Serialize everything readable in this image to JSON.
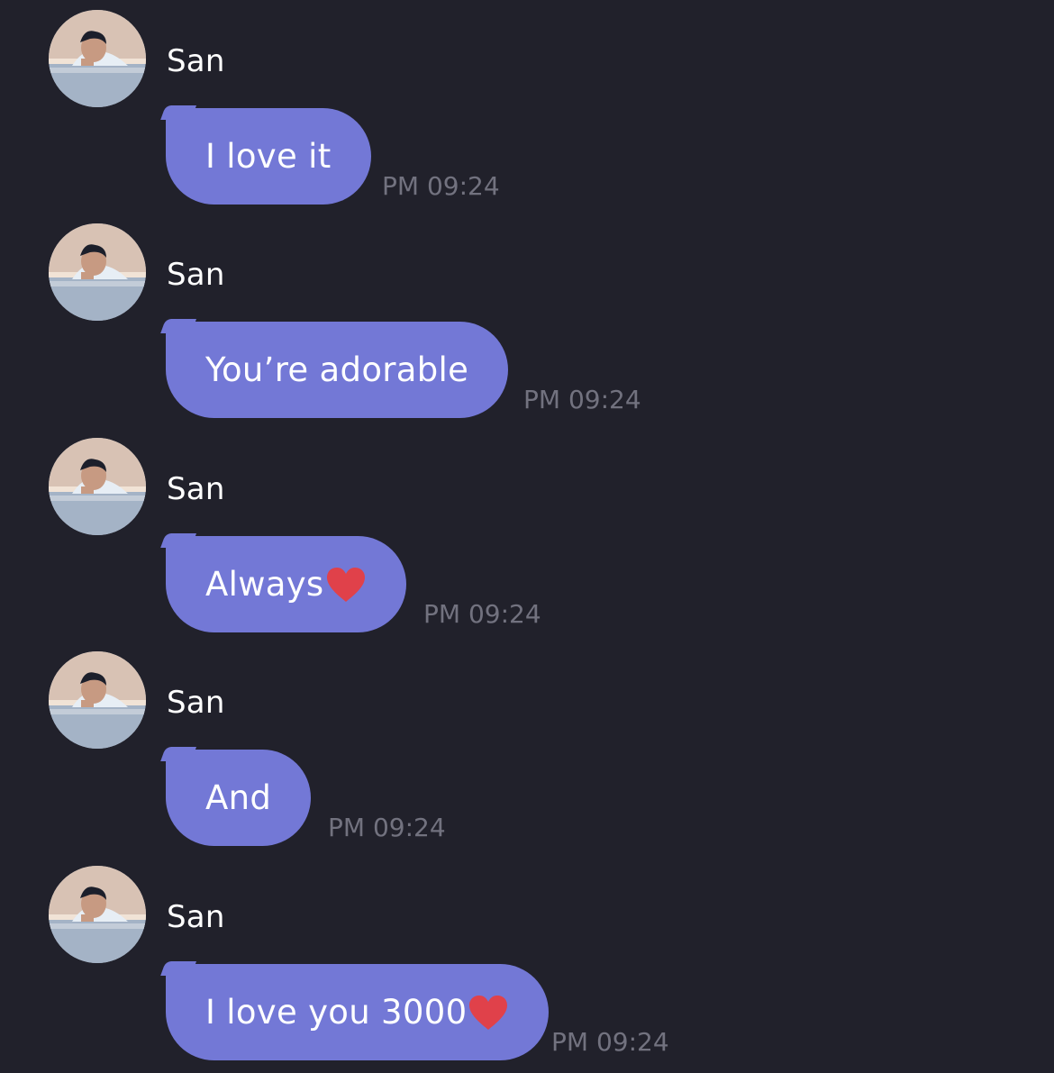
{
  "messages": [
    {
      "sender": "San",
      "text": "I love it",
      "time": "PM 09:24",
      "heart": false
    },
    {
      "sender": "San",
      "text": "You’re adorable",
      "time": "PM 09:24",
      "heart": false
    },
    {
      "sender": "San",
      "text": "Always",
      "time": "PM 09:24",
      "heart": true
    },
    {
      "sender": "San",
      "text": "And",
      "time": "PM 09:24",
      "heart": false
    },
    {
      "sender": "San",
      "text": "I love you 3000",
      "time": "PM 09:24",
      "heart": true
    }
  ],
  "icons": {
    "avatar": "profile-photo",
    "heart": "red-heart-emoji"
  },
  "colors": {
    "background": "#21212b",
    "bubble": "#7378d6",
    "timestamp": "#72727f",
    "heart": "#e0414a"
  }
}
